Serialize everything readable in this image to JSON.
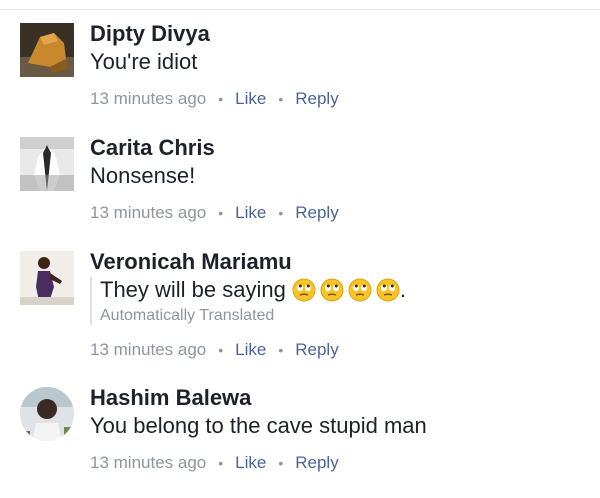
{
  "comments": [
    {
      "author": "Dipty Divya",
      "text": "You're idiot",
      "time": "13 minutes ago",
      "like_label": "Like",
      "reply_label": "Reply"
    },
    {
      "author": "Carita Chris",
      "text": "Nonsense!",
      "time": "13 minutes ago",
      "like_label": "Like",
      "reply_label": "Reply"
    },
    {
      "author": "Veronicah Mariamu",
      "text": "They will be saying",
      "emoji_count": 4,
      "text_suffix": ".",
      "translation_note": "Automatically Translated",
      "time": "13 minutes ago",
      "like_label": "Like",
      "reply_label": "Reply"
    },
    {
      "author": "Hashim Balewa",
      "text": "You belong to the cave stupid man",
      "time": "13 minutes ago",
      "like_label": "Like",
      "reply_label": "Reply"
    }
  ],
  "separator": "•",
  "colors": {
    "author": "#1d2129",
    "meta": "#90949c",
    "link": "#4b6496",
    "emoji": "#f7c325"
  }
}
